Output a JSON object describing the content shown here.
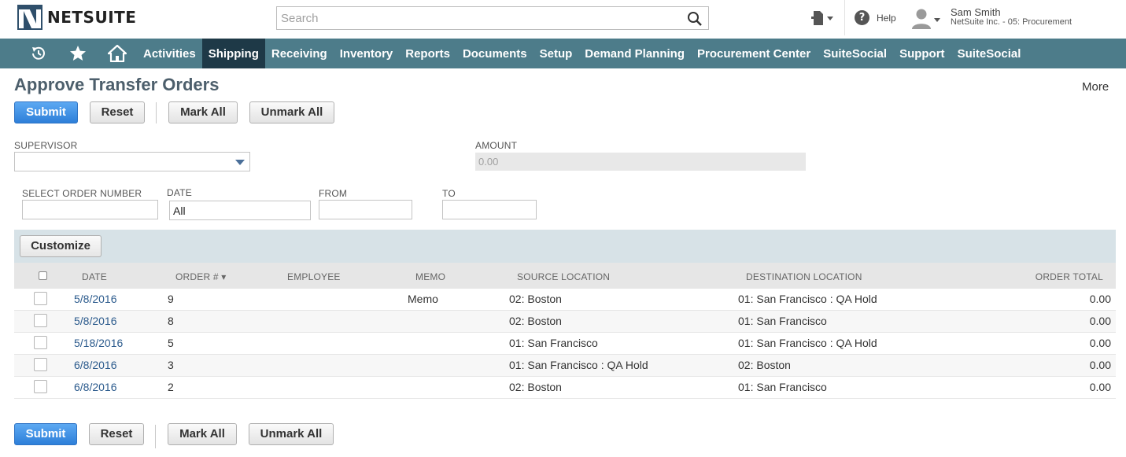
{
  "brand": {
    "logo_text": "NETSUITE"
  },
  "search": {
    "placeholder": "Search"
  },
  "header": {
    "help_label": "Help",
    "user_name": "Sam Smith",
    "user_role": "NetSuite Inc. - 05: Procurement"
  },
  "nav": {
    "icons": [
      "recent-records-icon",
      "favorites-star-icon",
      "home-icon"
    ],
    "items": [
      {
        "label": "Activities"
      },
      {
        "label": "Shipping",
        "active": true
      },
      {
        "label": "Receiving"
      },
      {
        "label": "Inventory"
      },
      {
        "label": "Reports"
      },
      {
        "label": "Documents"
      },
      {
        "label": "Setup"
      },
      {
        "label": "Demand Planning"
      },
      {
        "label": "Procurement Center"
      },
      {
        "label": "SuiteSocial"
      },
      {
        "label": "Support"
      },
      {
        "label": "SuiteSocial"
      }
    ]
  },
  "page": {
    "title": "Approve Transfer Orders",
    "more": "More"
  },
  "buttons": {
    "submit": "Submit",
    "reset": "Reset",
    "mark_all": "Mark All",
    "unmark_all": "Unmark All",
    "customize": "Customize"
  },
  "filters": {
    "supervisor_label": "SUPERVISOR",
    "supervisor_value": "",
    "amount_label": "AMOUNT",
    "amount_value": "0.00",
    "order_number_label": "SELECT ORDER NUMBER",
    "order_number_value": "",
    "date_label": "DATE",
    "date_value": "All",
    "from_label": "FROM",
    "from_value": "",
    "to_label": "TO",
    "to_value": ""
  },
  "table": {
    "headers": {
      "date": "DATE",
      "order": "ORDER # ▾",
      "employee": "EMPLOYEE",
      "memo": "MEMO",
      "source": "SOURCE LOCATION",
      "destination": "DESTINATION LOCATION",
      "total": "ORDER TOTAL"
    },
    "rows": [
      {
        "date": "5/8/2016",
        "order": "9",
        "employee": "",
        "memo": "Memo",
        "source": "02: Boston",
        "destination": "01: San Francisco : QA Hold",
        "total": "0.00"
      },
      {
        "date": "5/8/2016",
        "order": "8",
        "employee": "",
        "memo": "",
        "source": "02: Boston",
        "destination": "01: San Francisco",
        "total": "0.00"
      },
      {
        "date": "5/18/2016",
        "order": "5",
        "employee": "",
        "memo": "",
        "source": "01: San Francisco",
        "destination": "01: San Francisco : QA Hold",
        "total": "0.00"
      },
      {
        "date": "6/8/2016",
        "order": "3",
        "employee": "",
        "memo": "",
        "source": "01: San Francisco : QA Hold",
        "destination": "02: Boston",
        "total": "0.00"
      },
      {
        "date": "6/8/2016",
        "order": "2",
        "employee": "",
        "memo": "",
        "source": "02: Boston",
        "destination": "01: San Francisco",
        "total": "0.00"
      }
    ]
  },
  "colors": {
    "nav_bg": "#4d7c8a",
    "nav_active": "#1e3947",
    "primary_button": "#2d7fd9",
    "title": "#4d5f6c",
    "link": "#2c5b8d"
  }
}
